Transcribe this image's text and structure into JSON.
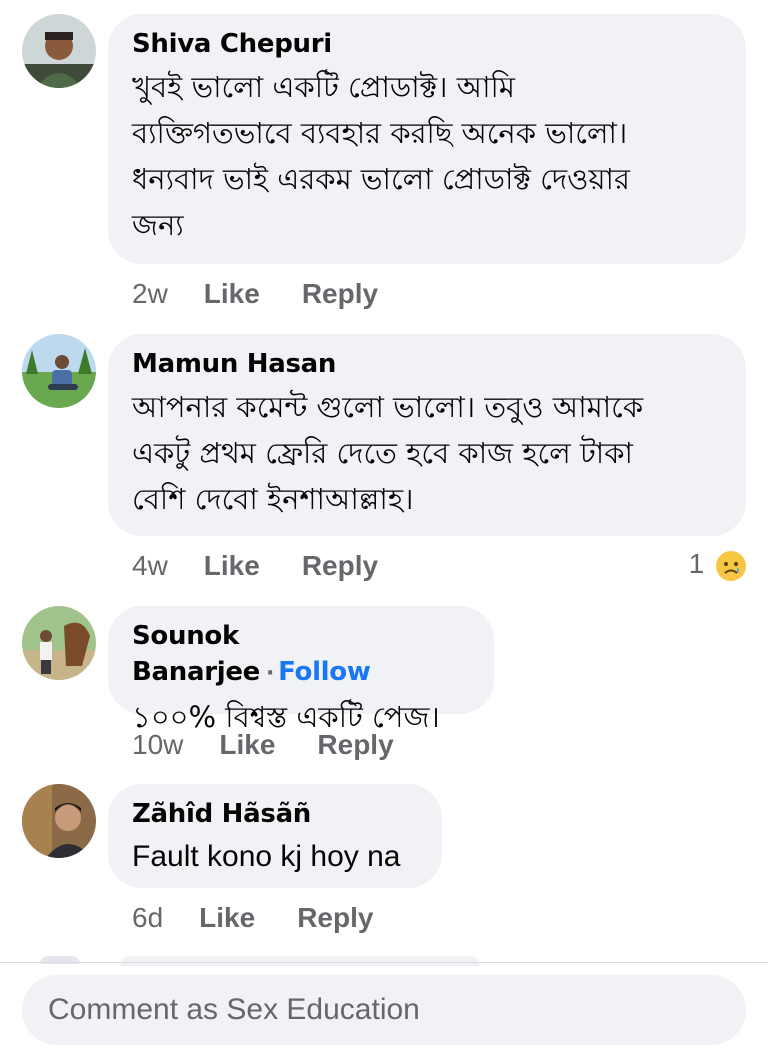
{
  "comments": [
    {
      "author": "Shiva Chepuri",
      "lines": [
        "খুবই ভালো একটি প্রোডাক্ট।  আমি",
        "ব্যক্তিগতভাবে ব্যবহার করছি অনেক ভালো।",
        "ধন্যবাদ ভাই এরকম ভালো প্রোডাক্ট দেওয়ার",
        "জন্য"
      ],
      "time": "2w",
      "like_label": "Like",
      "reply_label": "Reply"
    },
    {
      "author": "Mamun Hasan",
      "lines": [
        "আপনার কমেন্ট গুলো ভালো।  তবুও আমাকে",
        "একটু প্রথম ফ্রেরি দেতে হবে কাজ হলে টাকা",
        "বেশি দেবো ইনশাআল্লাহ।"
      ],
      "time": "4w",
      "like_label": "Like",
      "reply_label": "Reply",
      "reaction_count": "1",
      "reaction_icon": "sad-face-icon"
    },
    {
      "author": "Sounok Banarjee",
      "separator": "·",
      "follow_label": "Follow",
      "lines": [
        "১০০% বিশ্বস্ত একটি পেজ।"
      ],
      "time": "10w",
      "like_label": "Like",
      "reply_label": "Reply"
    },
    {
      "author": "Zãhîd Hãsãñ",
      "lines": [
        "Fault kono kj hoy na"
      ],
      "time": "6d",
      "like_label": "Like",
      "reply_label": "Reply"
    }
  ],
  "composer": {
    "placeholder": "Comment as Sex Education"
  },
  "colors": {
    "bubble": "#f0f2f5",
    "secondary_text": "#65676b",
    "follow": "#1877f2"
  }
}
